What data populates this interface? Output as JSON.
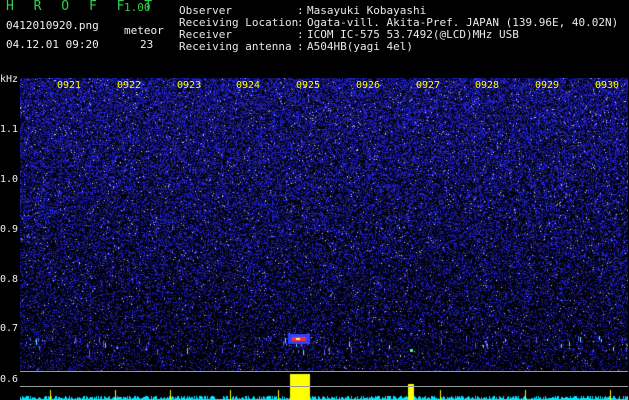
{
  "app": {
    "title": "H R O F F T",
    "version": "1.00",
    "file": "0412010920.png",
    "datetime": "04.12.01 09:20",
    "meteor_label": "meteor",
    "meteor_count": "23"
  },
  "info": [
    {
      "label": "Observer",
      "value": "Masayuki Kobayashi"
    },
    {
      "label": "Receiving Location",
      "value": "Ogata-vill. Akita-Pref. JAPAN (139.96E, 40.02N)"
    },
    {
      "label": "Receiver",
      "value": "ICOM IC-575 53.7492(@LCD)MHz USB"
    },
    {
      "label": "Receiving antenna",
      "value": "A504HB(yagi 4el)"
    }
  ],
  "colon": ":",
  "axis": {
    "unit": "kHz",
    "y_ticks": [
      "1.1",
      "1.0",
      "0.9",
      "0.8",
      "0.7",
      "0.6"
    ],
    "x_ticks": [
      "0921",
      "0922",
      "0923",
      "0924",
      "0925",
      "0926",
      "0927",
      "0928",
      "0929",
      "0930"
    ]
  },
  "colors": {
    "title_green": "#2fd34a",
    "tick_yellow": "#ffff00",
    "background": "#000000",
    "noise_blue": "#2a2ad0",
    "power_cyan": "#00e5ff",
    "power_peak": "#ffff00"
  }
}
